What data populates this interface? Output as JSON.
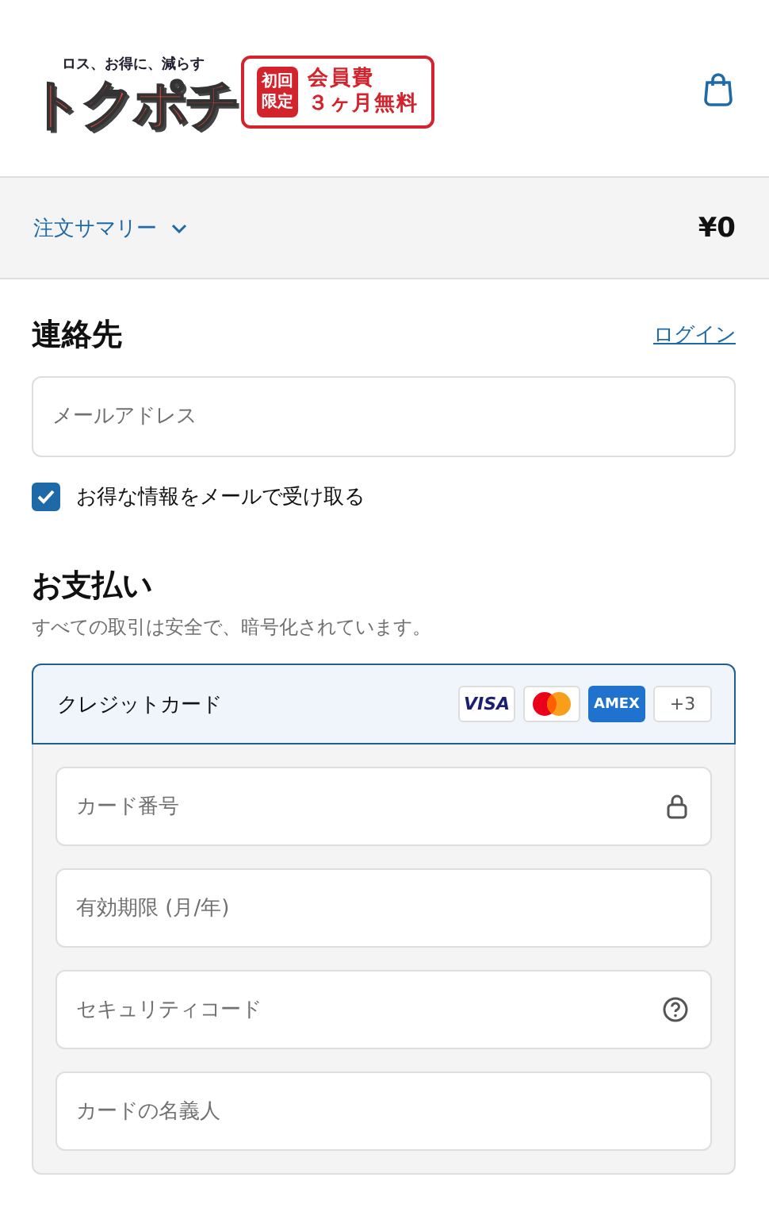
{
  "header": {
    "logo": {
      "tagline": "ロス、お得に、減らす",
      "name": "トクポチ",
      "badge_lines": [
        "初回",
        "限定"
      ],
      "offer_lines": [
        "会員費",
        "３ヶ月無料"
      ]
    }
  },
  "order_summary": {
    "label": "注文サマリー",
    "expanded": false,
    "total": "¥0"
  },
  "contact": {
    "heading": "連絡先",
    "login_link": "ログイン",
    "email": {
      "placeholder": "メールアドレス"
    },
    "newsletter": {
      "label": "お得な情報をメールで受け取る",
      "checked": true
    }
  },
  "payment": {
    "heading": "お支払い",
    "subtitle": "すべての取引は安全で、暗号化されています。",
    "method": {
      "label": "クレジットカード",
      "selected": true,
      "brands": [
        {
          "kind": "visa",
          "label": "VISA"
        },
        {
          "kind": "mastercard"
        },
        {
          "kind": "amex",
          "label": "AMEX"
        },
        {
          "kind": "more",
          "label": "+3"
        }
      ],
      "fields": [
        {
          "placeholder": "カード番号",
          "kind": "lock"
        },
        {
          "placeholder": "有効期限 (月/年)",
          "kind": "plain"
        },
        {
          "placeholder": "セキュリティコード",
          "kind": "help"
        },
        {
          "placeholder": "カードの名義人",
          "kind": "plain"
        }
      ]
    }
  }
}
